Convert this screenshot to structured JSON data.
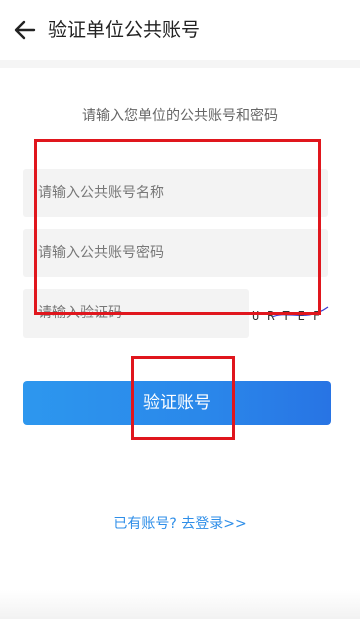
{
  "header": {
    "title": "验证单位公共账号",
    "back_icon": "arrow-left-icon"
  },
  "form": {
    "instruction": "请输入您单位的公共账号和密码",
    "account_placeholder": "请输入公共账号名称",
    "password_placeholder": "请输入公共账号密码",
    "captcha_placeholder": "请输入验证码",
    "captcha_text": "URTEF",
    "submit_label": "验证账号"
  },
  "footer": {
    "login_link": "已有账号? 去登录>>"
  },
  "colors": {
    "accent": "#2a87ea",
    "link": "#2e8ee8",
    "annotation": "#e0161d"
  }
}
